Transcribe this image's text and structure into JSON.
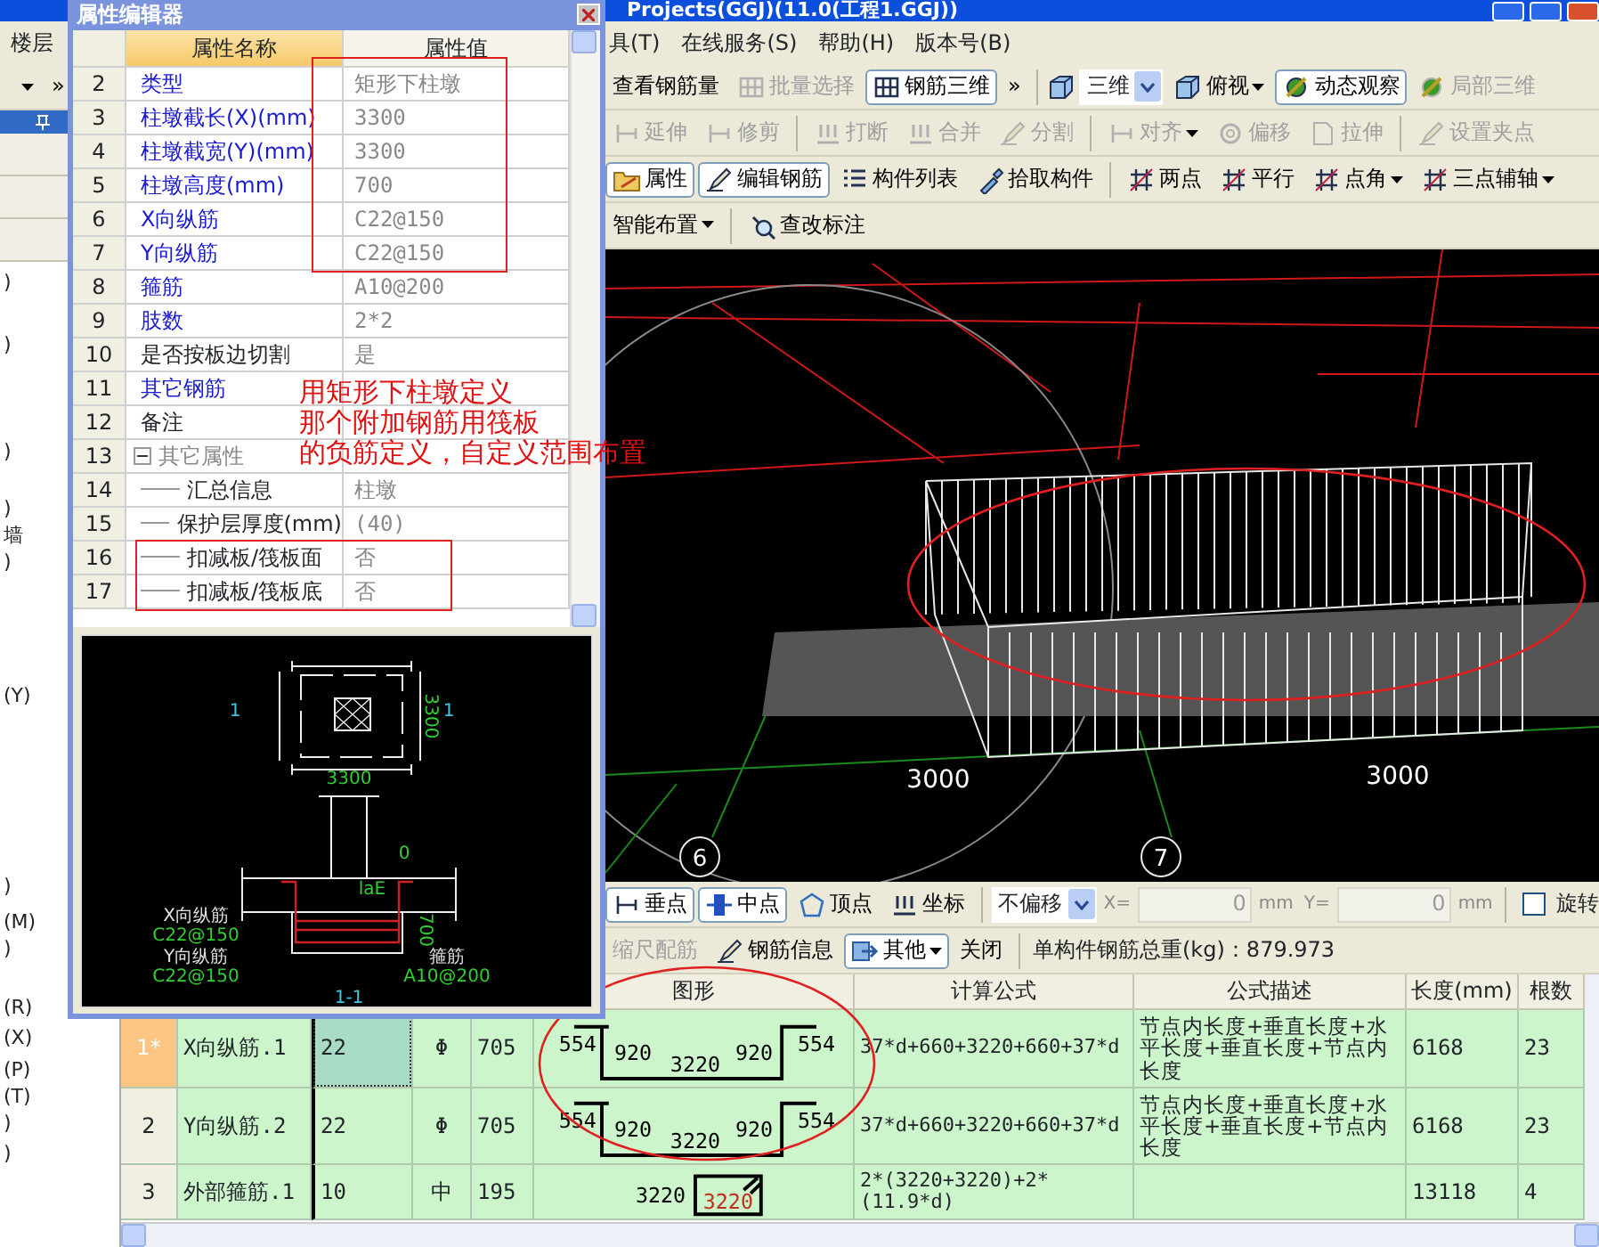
{
  "window": {
    "title": "Projects(GGJ)(11.0(工程1.GGJ))"
  },
  "menu": {
    "left": "楼层",
    "items": [
      "具(T)",
      "在线服务(S)",
      "帮助(H)",
      "版本号(B)"
    ]
  },
  "left_pane": {
    "more": "»",
    "list": [
      ")",
      ")",
      ")",
      ")",
      "墙",
      ")",
      "(Y)",
      ")",
      "(M)",
      ")",
      "(R)",
      "(X)",
      "(P)",
      "(T)",
      ")",
      ")"
    ]
  },
  "toolbars": [
    [
      {
        "kind": "button",
        "label": "查看钢筋量",
        "pressed": false,
        "disabled": false,
        "dropdown": false
      },
      {
        "kind": "button",
        "label": "批量选择",
        "pressed": false,
        "disabled": true,
        "dropdown": false
      },
      {
        "kind": "button",
        "label": "钢筋三维",
        "pressed": true,
        "disabled": false,
        "dropdown": false
      },
      {
        "kind": "button",
        "label": "»",
        "pressed": false,
        "disabled": false,
        "dropdown": false
      },
      {
        "kind": "separator"
      },
      {
        "kind": "combo",
        "label": "三维"
      },
      {
        "kind": "button",
        "label": "俯视",
        "pressed": false,
        "disabled": false,
        "dropdown": true
      },
      {
        "kind": "button",
        "label": "动态观察",
        "pressed": true,
        "disabled": false,
        "dropdown": false
      },
      {
        "kind": "button",
        "label": "局部三维",
        "pressed": false,
        "disabled": true,
        "dropdown": false
      }
    ],
    [
      {
        "kind": "button",
        "label": "延伸",
        "pressed": false,
        "disabled": true,
        "dropdown": false
      },
      {
        "kind": "button",
        "label": "修剪",
        "pressed": false,
        "disabled": true,
        "dropdown": false
      },
      {
        "kind": "separator"
      },
      {
        "kind": "button",
        "label": "打断",
        "pressed": false,
        "disabled": true,
        "dropdown": false
      },
      {
        "kind": "button",
        "label": "合并",
        "pressed": false,
        "disabled": true,
        "dropdown": false
      },
      {
        "kind": "button",
        "label": "分割",
        "pressed": false,
        "disabled": true,
        "dropdown": false
      },
      {
        "kind": "separator"
      },
      {
        "kind": "button",
        "label": "对齐",
        "pressed": false,
        "disabled": true,
        "dropdown": true
      },
      {
        "kind": "button",
        "label": "偏移",
        "pressed": false,
        "disabled": true,
        "dropdown": false
      },
      {
        "kind": "button",
        "label": "拉伸",
        "pressed": false,
        "disabled": true,
        "dropdown": false
      },
      {
        "kind": "separator"
      },
      {
        "kind": "button",
        "label": "设置夹点",
        "pressed": false,
        "disabled": true,
        "dropdown": false
      }
    ],
    [
      {
        "kind": "button",
        "label": "属性",
        "pressed": true,
        "disabled": false,
        "dropdown": false
      },
      {
        "kind": "button",
        "label": "编辑钢筋",
        "pressed": true,
        "disabled": false,
        "dropdown": false
      },
      {
        "kind": "button",
        "label": "构件列表",
        "pressed": false,
        "disabled": false,
        "dropdown": false
      },
      {
        "kind": "button",
        "label": "拾取构件",
        "pressed": false,
        "disabled": false,
        "dropdown": false
      },
      {
        "kind": "separator"
      },
      {
        "kind": "button",
        "label": "两点",
        "pressed": false,
        "disabled": false,
        "dropdown": false
      },
      {
        "kind": "button",
        "label": "平行",
        "pressed": false,
        "disabled": false,
        "dropdown": false
      },
      {
        "kind": "button",
        "label": "点角",
        "pressed": false,
        "disabled": false,
        "dropdown": true
      },
      {
        "kind": "button",
        "label": "三点辅轴",
        "pressed": false,
        "disabled": false,
        "dropdown": true
      }
    ],
    [
      {
        "kind": "button",
        "label": "智能布置",
        "pressed": false,
        "disabled": false,
        "dropdown": true
      },
      {
        "kind": "separator"
      },
      {
        "kind": "button",
        "label": "查改标注",
        "pressed": false,
        "disabled": false,
        "dropdown": false
      }
    ]
  ],
  "viewport": {
    "labels": [
      "3000",
      "3000"
    ],
    "axes": [
      "6",
      "7"
    ]
  },
  "snap_toolbars": [
    [
      {
        "kind": "button",
        "label": "垂点",
        "pressed": true,
        "disabled": false,
        "dropdown": false
      },
      {
        "kind": "button",
        "label": "中点",
        "pressed": true,
        "disabled": false,
        "dropdown": false
      },
      {
        "kind": "button",
        "label": "顶点",
        "pressed": false,
        "disabled": false,
        "dropdown": false
      },
      {
        "kind": "button",
        "label": "坐标",
        "pressed": false,
        "disabled": false,
        "dropdown": false
      },
      {
        "kind": "separator"
      },
      {
        "kind": "combo",
        "label": "不偏移"
      },
      {
        "kind": "label",
        "label": "X="
      },
      {
        "kind": "spin",
        "value": "0",
        "disabled": true
      },
      {
        "kind": "label",
        "label": "mm"
      },
      {
        "kind": "label",
        "label": "Y="
      },
      {
        "kind": "spin",
        "value": "0",
        "disabled": true
      },
      {
        "kind": "label",
        "label": "mm"
      },
      {
        "kind": "separator"
      },
      {
        "kind": "checkbox",
        "label": "旋转",
        "checked": false
      }
    ],
    [
      {
        "kind": "button",
        "label": "缩尺配筋",
        "pressed": false,
        "disabled": true,
        "dropdown": false
      },
      {
        "kind": "button",
        "label": "钢筋信息",
        "pressed": false,
        "disabled": false,
        "dropdown": false
      },
      {
        "kind": "button",
        "label": "其他",
        "pressed": true,
        "disabled": false,
        "dropdown": true
      },
      {
        "kind": "button",
        "label": "关闭",
        "pressed": false,
        "disabled": false,
        "dropdown": false
      },
      {
        "kind": "separator"
      },
      {
        "kind": "label",
        "label": "单构件钢筋总重(kg)：879.973"
      }
    ]
  ],
  "table": {
    "columns": [
      "图形",
      "计算公式",
      "公式描述",
      "长度(mm)",
      "根数"
    ],
    "rows": [
      {
        "selected": true,
        "number": "1*",
        "name": "X向纵筋.1",
        "diameter": "22",
        "grade": "Φ",
        "figure_no": "705",
        "shape": {
          "kind": "u_bar",
          "labels": [
            "554",
            "920",
            "3220",
            "920",
            "554"
          ]
        },
        "formula": "37*d+660+3220+660+37*d",
        "description": "节点内长度+垂直长度+水平长度+垂直长度+节点内长度",
        "length": "6168",
        "count": "23"
      },
      {
        "selected": false,
        "number": "2",
        "name": "Y向纵筋.2",
        "diameter": "22",
        "grade": "Φ",
        "figure_no": "705",
        "shape": {
          "kind": "u_bar",
          "labels": [
            "554",
            "920",
            "3220",
            "920",
            "554"
          ]
        },
        "formula": "37*d+660+3220+660+37*d",
        "description": "节点内长度+垂直长度+水平长度+垂直长度+节点内长度",
        "length": "6168",
        "count": "23"
      },
      {
        "selected": false,
        "number": "3",
        "name": "外部箍筋.1",
        "diameter": "10",
        "grade": "中",
        "figure_no": "195",
        "shape": {
          "kind": "stirrup",
          "labels": [
            "3220",
            "3220"
          ]
        },
        "formula": "2*(3220+3220)+2*(11.9*d)",
        "length": "13118",
        "count": "4"
      }
    ]
  },
  "property_editor": {
    "title": "属性编辑器",
    "columns": [
      "属性名称",
      "属性值"
    ],
    "rows": [
      {
        "number": "2",
        "kind": "primary",
        "name": "类型",
        "value": "矩形下柱墩"
      },
      {
        "number": "3",
        "kind": "primary",
        "name": "柱墩截长(X)(mm)",
        "value": "3300"
      },
      {
        "number": "4",
        "kind": "primary",
        "name": "柱墩截宽(Y)(mm)",
        "value": "3300"
      },
      {
        "number": "5",
        "kind": "primary",
        "name": "柱墩高度(mm)",
        "value": "700"
      },
      {
        "number": "6",
        "kind": "primary",
        "name": "X向纵筋",
        "value": "C22@150"
      },
      {
        "number": "7",
        "kind": "primary",
        "name": "Y向纵筋",
        "value": "C22@150"
      },
      {
        "number": "8",
        "kind": "primary",
        "name": "箍筋",
        "value": "A10@200"
      },
      {
        "number": "9",
        "kind": "primary",
        "name": "肢数",
        "value": "2*2"
      },
      {
        "number": "10",
        "kind": "plain",
        "name": "是否按板边切割",
        "value": "是"
      },
      {
        "number": "11",
        "kind": "primary",
        "name": "其它钢筋"
      },
      {
        "number": "12",
        "kind": "plain",
        "name": "备注"
      },
      {
        "number": "13",
        "kind": "group",
        "name": "其它属性",
        "expanded": true,
        "children": [
          {
            "number": "14",
            "name": "汇总信息",
            "value": "柱墩"
          },
          {
            "number": "15",
            "name": "保护层厚度(mm)",
            "value": "(40)"
          },
          {
            "number": "16",
            "name": "扣减板/筏板面",
            "value": "否"
          },
          {
            "number": "17",
            "name": "扣减板/筏板底",
            "value": "否"
          }
        ]
      }
    ],
    "preview": {
      "labels": [
        "1",
        "1",
        "3300",
        "3300",
        "0",
        "laE",
        "700",
        "X向纵筋",
        "C22@150",
        "Y向纵筋",
        "C22@150",
        "箍筋",
        "A10@200",
        "1-1"
      ]
    }
  },
  "annotation": [
    "用矩形下柱墩定义",
    "那个附加钢筋用筏板",
    "的负筋定义，自定义范围布置"
  ]
}
